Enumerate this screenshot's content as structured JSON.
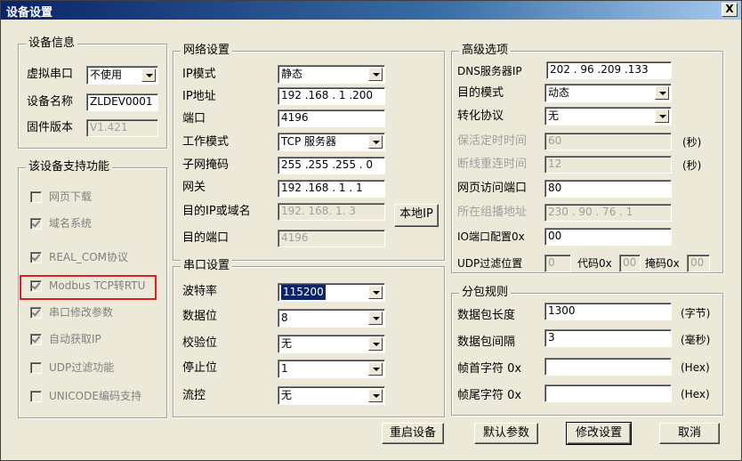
{
  "window": {
    "title": "设备设置",
    "close": "X"
  },
  "device_info": {
    "title": "设备信息",
    "vcom_label": "虚拟串口",
    "vcom_value": "不使用",
    "name_label": "设备名称",
    "name_value": "ZLDEV0001",
    "fw_label": "固件版本",
    "fw_value": "V1.421"
  },
  "features": {
    "title": "该设备支持功能",
    "items": [
      {
        "label": "网页下载",
        "checked": false
      },
      {
        "label": "域名系统",
        "checked": true
      },
      {
        "label": "REAL_COM协议",
        "checked": true
      },
      {
        "label": "Modbus TCP转RTU",
        "checked": true
      },
      {
        "label": "串口修改参数",
        "checked": true
      },
      {
        "label": "自动获取IP",
        "checked": true
      },
      {
        "label": "UDP过滤功能",
        "checked": false
      },
      {
        "label": "UNICODE编码支持",
        "checked": false
      }
    ]
  },
  "network": {
    "title": "网络设置",
    "ip_mode_label": "IP模式",
    "ip_mode": "静态",
    "ip_label": "IP地址",
    "ip": "192 .168 . 1  .200",
    "port_label": "端口",
    "port": "4196",
    "work_mode_label": "工作模式",
    "work_mode": "TCP 服务器",
    "mask_label": "子网掩码",
    "mask": "255 .255 .255 . 0",
    "gw_label": "网关",
    "gw": "192 .168 . 1  . 1",
    "dest_ip_label": "目的IP或域名",
    "dest_ip": "192. 168. 1. 3",
    "local_ip_btn": "本地IP",
    "dest_port_label": "目的端口",
    "dest_port": "4196"
  },
  "serial": {
    "title": "串口设置",
    "baud_label": "波特率",
    "baud": "115200",
    "data_label": "数据位",
    "data": "8",
    "parity_label": "校验位",
    "parity": "无",
    "stop_label": "停止位",
    "stop": "1",
    "flow_label": "流控",
    "flow": "无"
  },
  "advanced": {
    "title": "高级选项",
    "dns_label": "DNS服务器IP",
    "dns": "202 . 96  .209 .133",
    "dest_mode_label": "目的模式",
    "dest_mode": "动态",
    "proto_label": "转化协议",
    "proto": "无",
    "keepalive_label": "保活定时时间",
    "keepalive": "60",
    "keepalive_unit": "(秒)",
    "reconnect_label": "断线重连时间",
    "reconnect": "12",
    "reconnect_unit": "(秒)",
    "web_port_label": "网页访问端口",
    "web_port": "80",
    "mcast_label": "所在组播地址",
    "mcast": " 230 . 90  . 76  . 1",
    "io_label": "IO端口配置0x",
    "io": "00",
    "udp_label": "UDP过滤位置",
    "udp_pos": "0",
    "code_label": "代码0x",
    "code": "00",
    "mask_label": "掩码0x",
    "mask": "00"
  },
  "packet": {
    "title": "分包规则",
    "len_label": "数据包长度",
    "len": "1300",
    "len_unit": "(字节)",
    "interval_label": "数据包间隔",
    "interval": "3",
    "interval_unit": "(毫秒)",
    "head_label": "帧首字符 0x",
    "head": "",
    "head_unit": "(Hex)",
    "tail_label": "帧尾字符 0x",
    "tail": "",
    "tail_unit": "(Hex)"
  },
  "buttons": {
    "restart": "重启设备",
    "defaults": "默认参数",
    "modify": "修改设置",
    "cancel": "取消"
  },
  "colors": {
    "title_bar": "#0a246a",
    "highlight_box": "#e02020",
    "window_bg": "#ece9d8"
  }
}
